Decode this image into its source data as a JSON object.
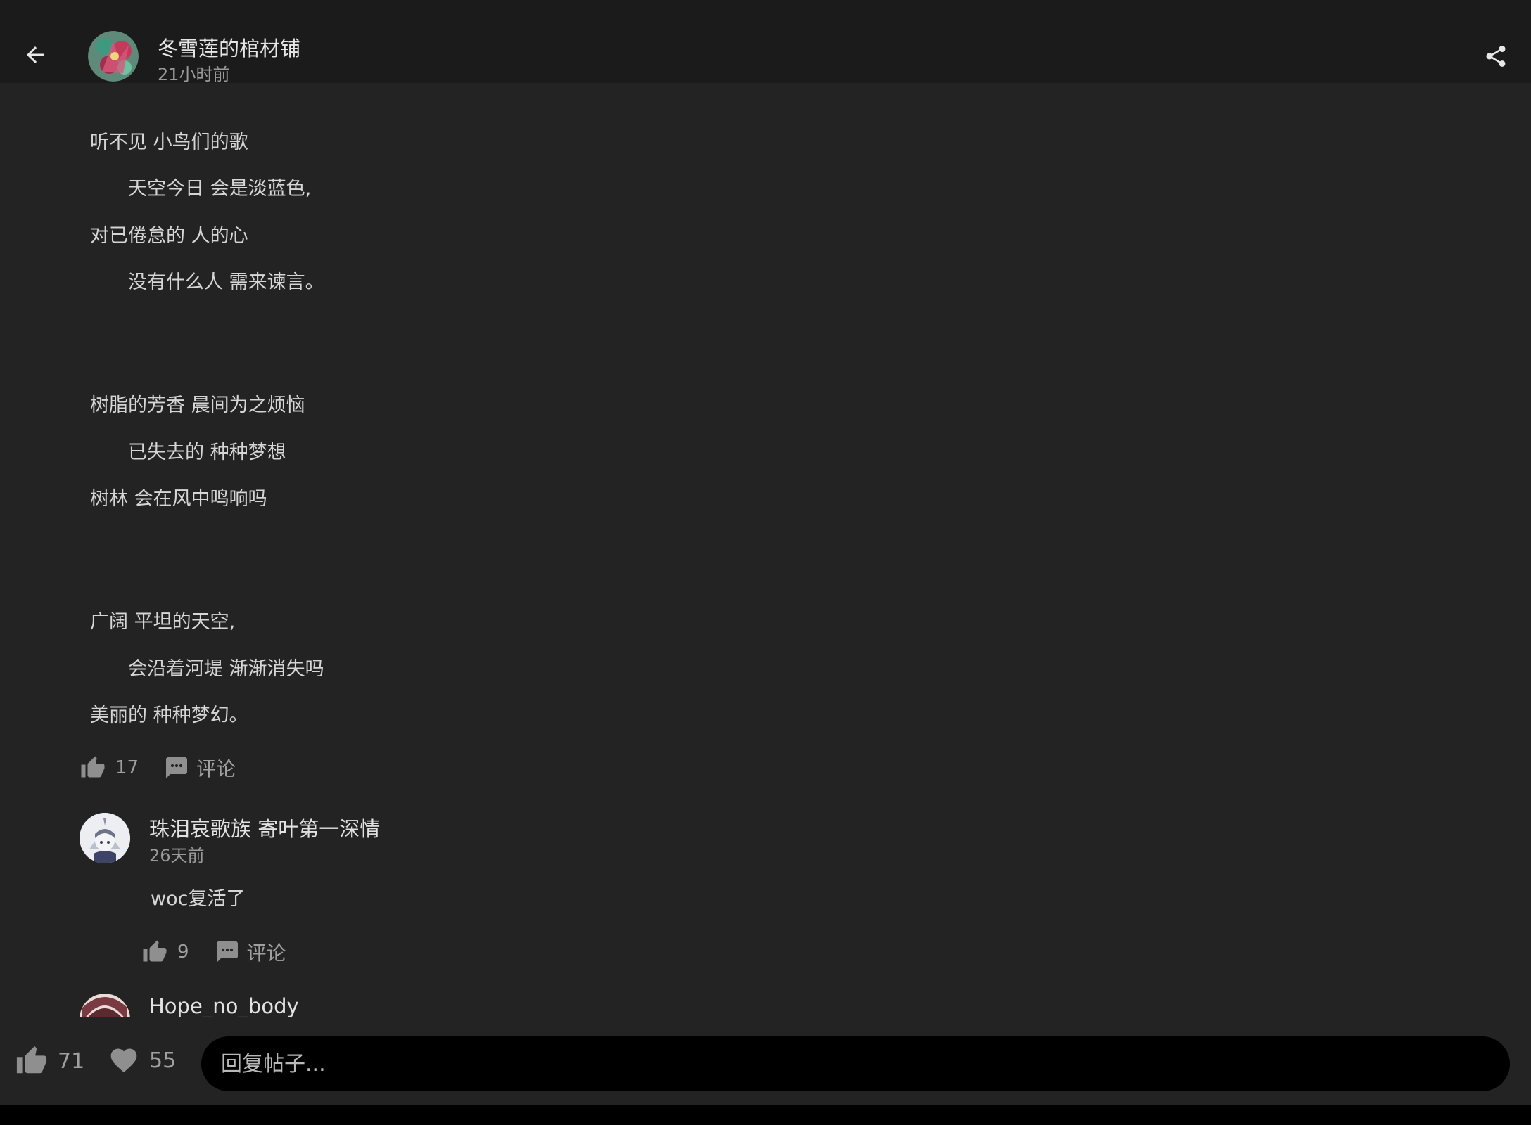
{
  "header": {
    "author": "冬雪莲的棺材铺",
    "time": "21小时前"
  },
  "post": {
    "lines": [
      {
        "text": "听不见 小鸟们的歌",
        "indent": false
      },
      {
        "text": "天空今日 会是淡蓝色,",
        "indent": true
      },
      {
        "text": "对已倦怠的 人的心",
        "indent": false
      },
      {
        "text": "没有什么人 需来谏言。",
        "indent": true
      },
      {
        "text": "树脂的芳香 晨间为之烦恼",
        "indent": false
      },
      {
        "text": "已失去的 种种梦想",
        "indent": true
      },
      {
        "text": "树林 会在风中鸣响吗",
        "indent": false
      },
      {
        "text": "广阔 平坦的天空,",
        "indent": false
      },
      {
        "text": "会沿着河堤 渐渐消失吗",
        "indent": true
      },
      {
        "text": "美丽的 种种梦幻。",
        "indent": false
      }
    ],
    "likes": "17",
    "comment_label": "评论"
  },
  "comments": [
    {
      "author": "珠泪哀歌族 寄叶第一深情",
      "time": "26天前",
      "text": "woc复活了",
      "likes": "9",
      "comment_label": "评论"
    },
    {
      "author": "Hope_no_body"
    }
  ],
  "bottom": {
    "likes": "71",
    "favorites": "55",
    "reply_placeholder": "回复帖子..."
  }
}
